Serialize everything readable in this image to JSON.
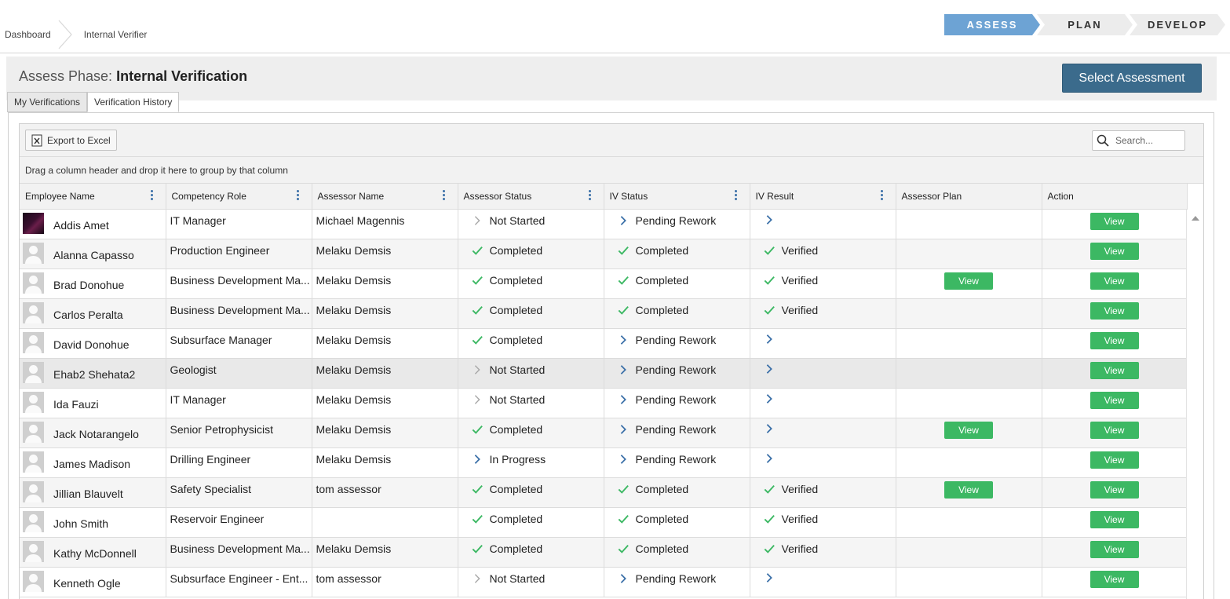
{
  "breadcrumb": {
    "items": [
      "Dashboard",
      "Internal Verifier"
    ]
  },
  "steps": [
    "ASSESS",
    "PLAN",
    "DEVELOP"
  ],
  "phase": {
    "prefix": "Assess Phase:",
    "title": "Internal Verification",
    "select_button": "Select Assessment"
  },
  "tabs": [
    "My Verifications",
    "Verification History"
  ],
  "toolbar": {
    "export_label": "Export to Excel",
    "search_placeholder": "Search..."
  },
  "group_hint": "Drag a column header and drop it here to group by that column",
  "columns": [
    "Employee Name",
    "Competency Role",
    "Assessor Name",
    "Assessor Status",
    "IV Status",
    "IV Result",
    "Assessor Plan",
    "Action"
  ],
  "colors": {
    "accent": "#6da3d4",
    "primary_button": "#3b6b8c",
    "view_button": "#3cb863",
    "check": "#3cb863",
    "chevron": "#3a6fa8"
  },
  "rows": [
    {
      "name": "Addis Amet",
      "role": "IT Manager",
      "assessor": "Michael Magennis",
      "assessor_status": "Not Started",
      "iv_status": "Pending Rework",
      "iv_result": "",
      "plan": "",
      "action": "View"
    },
    {
      "name": "Alanna Capasso",
      "role": "Production Engineer",
      "assessor": "Melaku Demsis",
      "assessor_status": "Completed",
      "iv_status": "Completed",
      "iv_result": "Verified",
      "plan": "",
      "action": "View"
    },
    {
      "name": "Brad Donohue",
      "role": "Business Development Ma...",
      "assessor": "Melaku Demsis",
      "assessor_status": "Completed",
      "iv_status": "Completed",
      "iv_result": "Verified",
      "plan": "View",
      "action": "View"
    },
    {
      "name": "Carlos Peralta",
      "role": "Business Development Ma...",
      "assessor": "Melaku Demsis",
      "assessor_status": "Completed",
      "iv_status": "Completed",
      "iv_result": "Verified",
      "plan": "",
      "action": "View"
    },
    {
      "name": "David Donohue",
      "role": "Subsurface Manager",
      "assessor": "Melaku Demsis",
      "assessor_status": "Completed",
      "iv_status": "Pending Rework",
      "iv_result": "",
      "plan": "",
      "action": "View"
    },
    {
      "name": "Ehab2 Shehata2",
      "role": "Geologist",
      "assessor": "Melaku Demsis",
      "assessor_status": "Not Started",
      "iv_status": "Pending Rework",
      "iv_result": "",
      "plan": "",
      "action": "View"
    },
    {
      "name": "Ida Fauzi",
      "role": "IT Manager",
      "assessor": "Melaku Demsis",
      "assessor_status": "Not Started",
      "iv_status": "Pending Rework",
      "iv_result": "",
      "plan": "",
      "action": "View"
    },
    {
      "name": "Jack Notarangelo",
      "role": "Senior Petrophysicist",
      "assessor": "Melaku Demsis",
      "assessor_status": "Completed",
      "iv_status": "Pending Rework",
      "iv_result": "",
      "plan": "View",
      "action": "View"
    },
    {
      "name": "James Madison",
      "role": "Drilling Engineer",
      "assessor": "Melaku Demsis",
      "assessor_status": "In Progress",
      "iv_status": "Pending Rework",
      "iv_result": "",
      "plan": "",
      "action": "View"
    },
    {
      "name": "Jillian Blauvelt",
      "role": "Safety Specialist",
      "assessor": "tom assessor",
      "assessor_status": "Completed",
      "iv_status": "Completed",
      "iv_result": "Verified",
      "plan": "View",
      "action": "View"
    },
    {
      "name": "John Smith",
      "role": "Reservoir Engineer",
      "assessor": "",
      "assessor_status": "Completed",
      "iv_status": "Completed",
      "iv_result": "Verified",
      "plan": "",
      "action": "View"
    },
    {
      "name": "Kathy McDonnell",
      "role": "Business Development Ma...",
      "assessor": "Melaku Demsis",
      "assessor_status": "Completed",
      "iv_status": "Completed",
      "iv_result": "Verified",
      "plan": "",
      "action": "View"
    },
    {
      "name": "Kenneth Ogle",
      "role": "Subsurface Engineer - Ent...",
      "assessor": "tom assessor",
      "assessor_status": "Not Started",
      "iv_status": "Pending Rework",
      "iv_result": "",
      "plan": "",
      "action": "View"
    }
  ]
}
